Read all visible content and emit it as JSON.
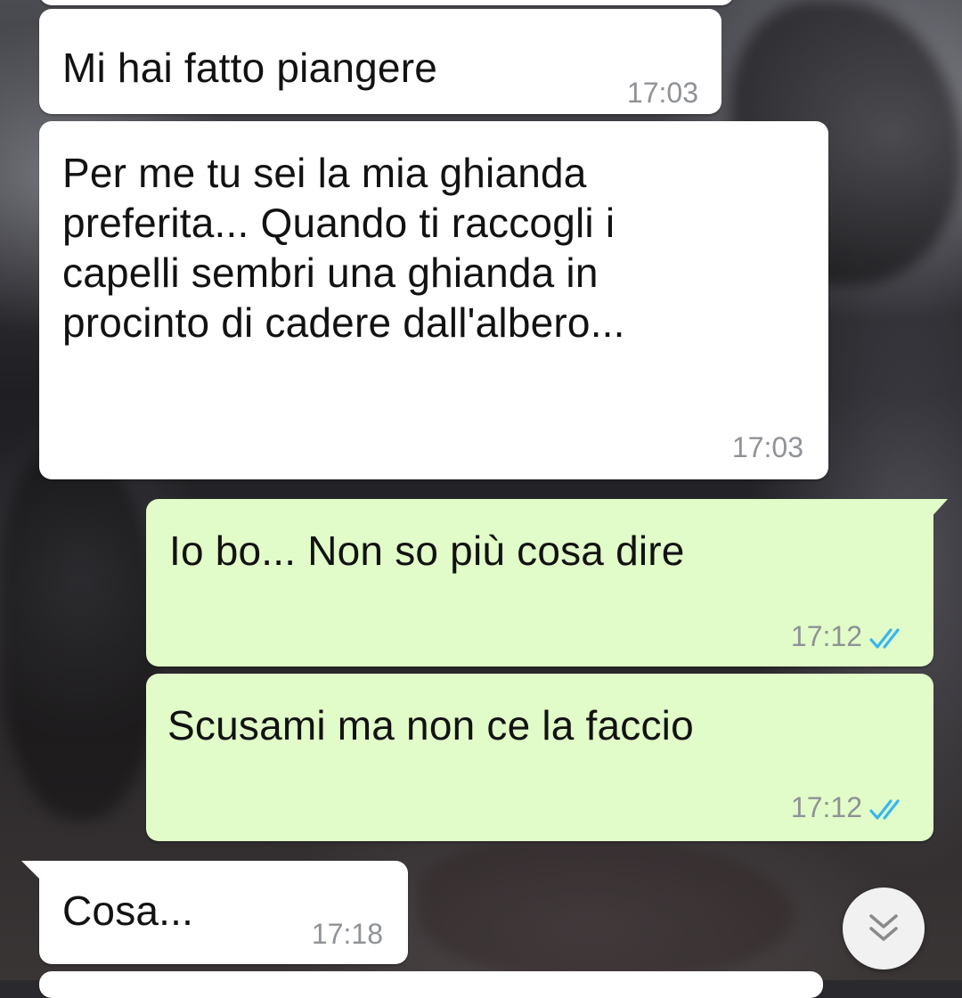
{
  "colors": {
    "incoming_bubble": "#ffffff",
    "outgoing_bubble": "#e1fcc8",
    "timestamp": "#8f9296",
    "read_ticks": "#34b7f1"
  },
  "messages": [
    {
      "direction": "incoming",
      "text": "Mi hai fatto piangere",
      "time": "17:03"
    },
    {
      "direction": "incoming",
      "text": "Per me tu sei la mia ghianda\npreferita... Quando ti raccogli i\ncapelli sembri una ghianda in\nprocinto di cadere dall'albero...",
      "time": "17:03"
    },
    {
      "direction": "outgoing",
      "text": "Io bo... Non so più cosa dire",
      "time": "17:12",
      "status": "read"
    },
    {
      "direction": "outgoing",
      "text": "Scusami ma non ce la faccio",
      "time": "17:12",
      "status": "read"
    },
    {
      "direction": "incoming",
      "text": "Cosa...",
      "time": "17:18"
    }
  ],
  "scroll_button": {
    "icon": "double-chevron-down-icon"
  }
}
